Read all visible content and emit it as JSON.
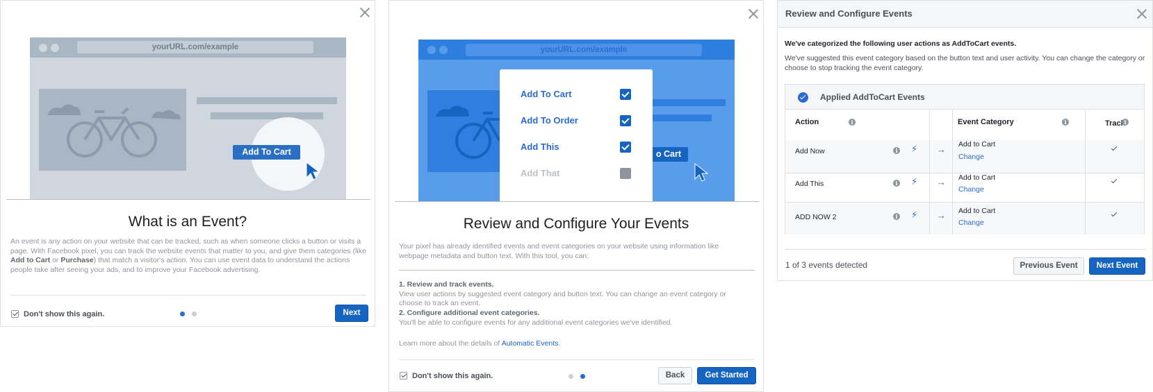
{
  "panel1": {
    "illustration": {
      "url": "yourURL.com/example",
      "button": "Add To Cart"
    },
    "title": "What is an Event?",
    "body": {
      "p1": "An event is any action on your website that can be tracked, such as when someone clicks a button or visits a page. With Facebook pixel, you can track the website events that matter to you, and give them categories (like ",
      "bold1": "Add to Cart",
      "or": " or ",
      "bold2": "Purchase",
      "p2": ") that match a visitor's action. You can use event data to understand the actions people take after seeing your ads, and to improve your Facebook advertising."
    },
    "dont_show": "Don't show this again.",
    "pager": {
      "pages": 2,
      "active": 1
    },
    "next_button": "Next"
  },
  "panel2": {
    "illustration": {
      "url": "yourURL.com/example",
      "button": "o Cart",
      "items": [
        {
          "label": "Add To Cart",
          "checked": true
        },
        {
          "label": "Add To Order",
          "checked": true
        },
        {
          "label": "Add This",
          "checked": true
        },
        {
          "label": "Add That",
          "checked": false
        }
      ]
    },
    "title": "Review and Configure Your Events",
    "intro": "Your pixel has already identified events and event categories on your website using information like webpage metadata and button text. With this tool, you can:",
    "step1_title": "1. Review and track events.",
    "step1_text": "View user actions by suggested event category and button text. You can change an event category or choose to track an event.",
    "step2_title": "2. Configure additional event categories.",
    "step2_text": "You'll be able to configure events for any additional event categories we've identified.",
    "learn_prefix": "Learn more about the details of ",
    "learn_link": "Automatic Events",
    "learn_suffix": ".",
    "dont_show": "Don't show this again.",
    "pager": {
      "pages": 2,
      "active": 2
    },
    "back_button": "Back",
    "start_button": "Get Started"
  },
  "panel3": {
    "title": "Review and Configure Events",
    "strong_text": "We've categorized the following user actions as AddToCart events.",
    "text": "We've suggested this event category based on the button text and user activity. You can change the category or choose to stop tracking the event category.",
    "table": {
      "heading": "Applied AddToCart Events",
      "col_action": "Action",
      "col_category": "Event Category",
      "col_track": "Track",
      "rows": [
        {
          "action": "Add Now",
          "category": "Add to Cart",
          "change": "Change",
          "tracked": true
        },
        {
          "action": "Add This",
          "category": "Add to Cart",
          "change": "Change",
          "tracked": true
        },
        {
          "action": "ADD NOW 2",
          "category": "Add to Cart",
          "change": "Change",
          "tracked": true
        }
      ]
    },
    "count": "1 of 3 events detected",
    "prev_button": "Previous Event",
    "next_button": "Next Event"
  },
  "colors": {
    "primary": "#1564c0",
    "illustration_blue": "#5a9cec",
    "illustration_gray": "#cfd6de"
  },
  "icons": [
    "close-icon",
    "checkbox-icon",
    "bicycle-icon",
    "cursor-icon",
    "info-icon",
    "bolt-icon",
    "arrow-right-icon",
    "check-icon"
  ]
}
